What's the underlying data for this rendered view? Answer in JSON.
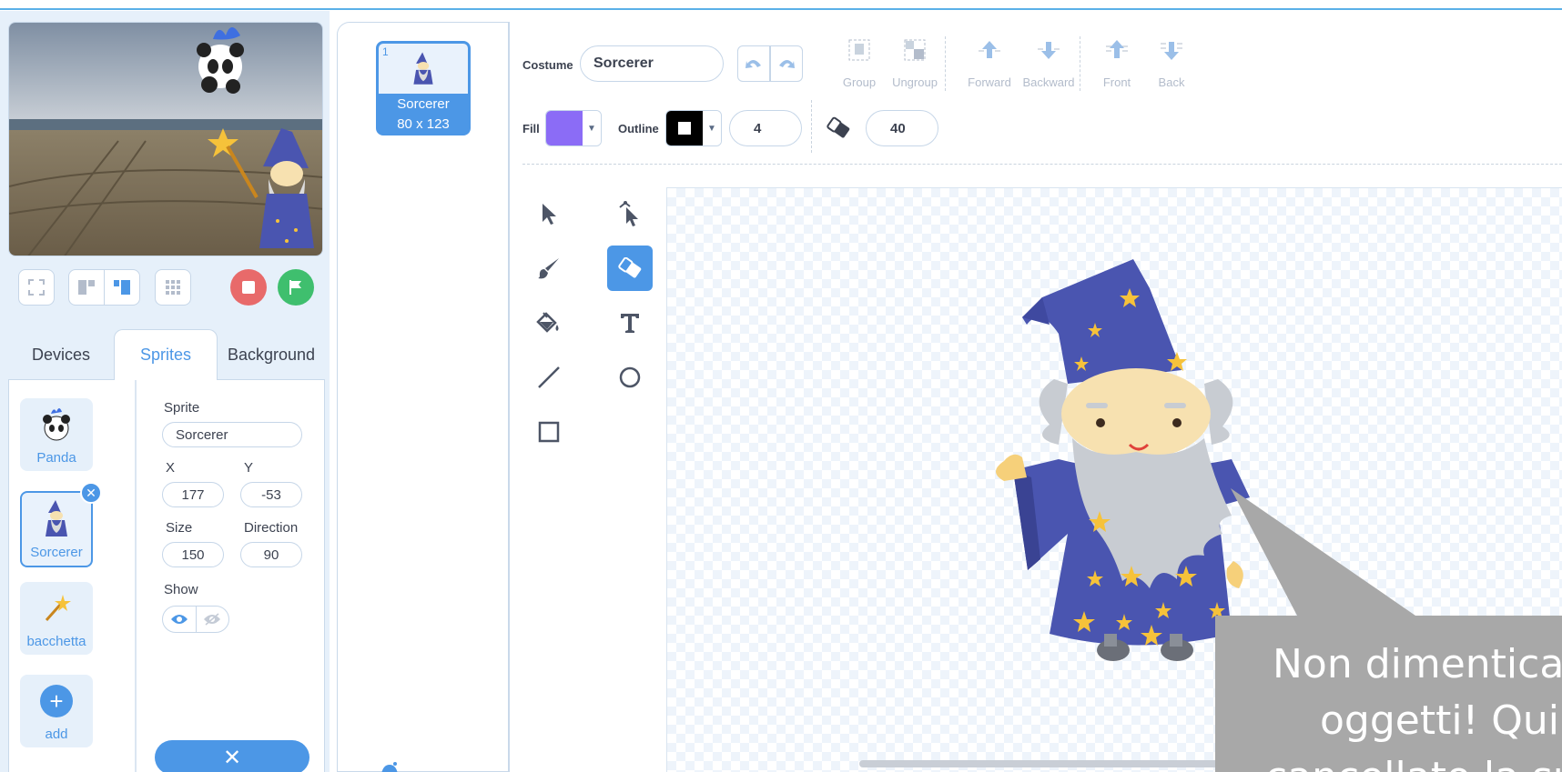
{
  "left_panel": {
    "stage_controls": [
      "fullscreen",
      "small-stage",
      "large-stage",
      "grid"
    ],
    "tabs": [
      "Devices",
      "Sprites",
      "Background"
    ],
    "active_tab": "Sprites",
    "sprites": [
      {
        "name": "Panda"
      },
      {
        "name": "Sorcerer",
        "selected": true
      },
      {
        "name": "bacchetta"
      },
      {
        "name": "add"
      }
    ],
    "props": {
      "sprite_label": "Sprite",
      "sprite_value": "Sorcerer",
      "x_label": "X",
      "x_value": "177",
      "y_label": "Y",
      "y_value": "-53",
      "size_label": "Size",
      "size_value": "150",
      "direction_label": "Direction",
      "direction_value": "90",
      "show_label": "Show"
    },
    "close_symbol": "✕"
  },
  "costumes": [
    {
      "index": "1",
      "name": "Sorcerer",
      "size": "80 x 123"
    }
  ],
  "editor": {
    "costume_label": "Costume",
    "costume_name": "Sorcerer",
    "toolbar": [
      "Group",
      "Ungroup",
      "Forward",
      "Backward",
      "Front",
      "Back"
    ],
    "fill_label": "Fill",
    "fill_color": "#8b6cf6",
    "outline_label": "Outline",
    "outline_color": "#000000",
    "outline_width": "4",
    "eraser_size": "40",
    "tools": [
      "select",
      "reshape",
      "brush",
      "eraser",
      "fill",
      "text",
      "line",
      "circle",
      "rectangle"
    ],
    "active_tool": "eraser"
  },
  "callout": {
    "line1": "Non dimentica",
    "line2": "oggetti! Qui",
    "line3": "cancellato la su"
  },
  "colors": {
    "accent": "#4c97e6",
    "stop": "#e86a6a",
    "go": "#3fbf6e"
  }
}
